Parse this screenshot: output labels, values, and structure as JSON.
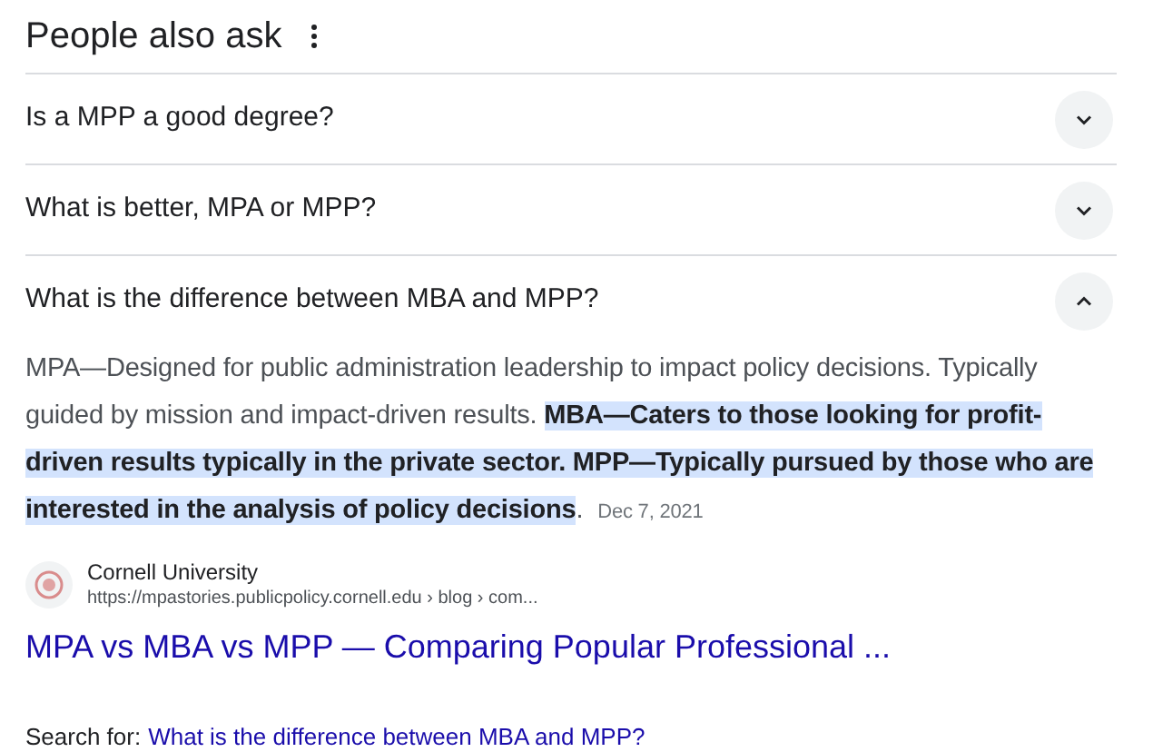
{
  "heading": "People also ask",
  "questions": [
    {
      "text": "Is a MPP a good degree?",
      "expanded": false
    },
    {
      "text": "What is better, MPA or MPP?",
      "expanded": false
    },
    {
      "text": "What is the difference between MBA and MPP?",
      "expanded": true
    }
  ],
  "answer": {
    "segments": [
      {
        "text": "MPA—Designed for public administration leadership to impact policy decisions. Typically guided by mission and impact-driven results. ",
        "highlighted": false
      },
      {
        "text": "MBA—Caters to those looking for profit-driven results typically in the private sector. MPP—Typically pursued by those who are interested in the analysis of policy decisions",
        "highlighted": true
      },
      {
        "text": ".",
        "highlighted": false
      }
    ],
    "date": "Dec 7, 2021"
  },
  "source": {
    "name": "Cornell University",
    "url": "https://mpastories.publicpolicy.cornell.edu › blog › com...",
    "title": "MPA vs MBA vs MPP — Comparing Popular Professional ..."
  },
  "search_for": {
    "label": "Search for:",
    "query": "What is the difference between MBA and MPP?"
  }
}
